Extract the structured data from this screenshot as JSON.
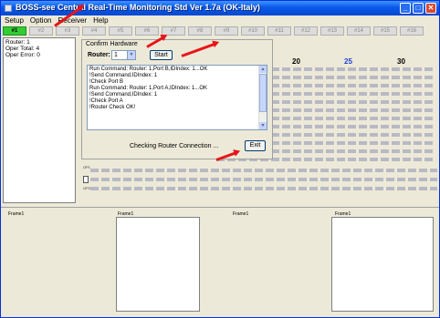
{
  "window": {
    "title": "BOSS-see Central Real-Time Monitoring Std Ver 1.7a (OK-Italy)"
  },
  "menu": [
    "Setup",
    "Option",
    "Receiver",
    "Help"
  ],
  "tabs": [
    "#1",
    "#2",
    "#3",
    "#4",
    "#5",
    "#6",
    "#7",
    "#8",
    "#9",
    "#10",
    "#11",
    "#12",
    "#13",
    "#14",
    "#15",
    "#16"
  ],
  "info": {
    "router": "Router: 1",
    "oper_total": "Oper Total: 4",
    "oper_error": "Oper Error: 0"
  },
  "grid": {
    "numbers": [
      {
        "text": "20",
        "color": "#000000"
      },
      {
        "text": "25",
        "color": "#1f3fd6"
      },
      {
        "text": "30",
        "color": "#000000"
      }
    ],
    "op_labels": [
      "OP1",
      "OP2"
    ]
  },
  "dialog": {
    "title": "Confirm Hardware",
    "router_label": "Router:",
    "router_value": "1",
    "start_label": "Start",
    "log": [
      "Run Command: Router: 1,Port B,IDIndex: 1...OK",
      "!Send Command,IDIndex: 1",
      "!Check Port B",
      "Run Command: Router: 1,Port A,IDIndex: 1...OK",
      "!Send Command,IDIndex: 1",
      "!Check Port A",
      "!Router Check OK!"
    ],
    "status": "Checking Router Connection ...",
    "exit_label": "Exit"
  },
  "frames": [
    "Frame1",
    "Frame1",
    "Frame1",
    "Frame1"
  ],
  "colors": {
    "annotation_arrow": "#e8141a",
    "active_tab": "#33cc33",
    "titlebar": "#0a58e8"
  }
}
